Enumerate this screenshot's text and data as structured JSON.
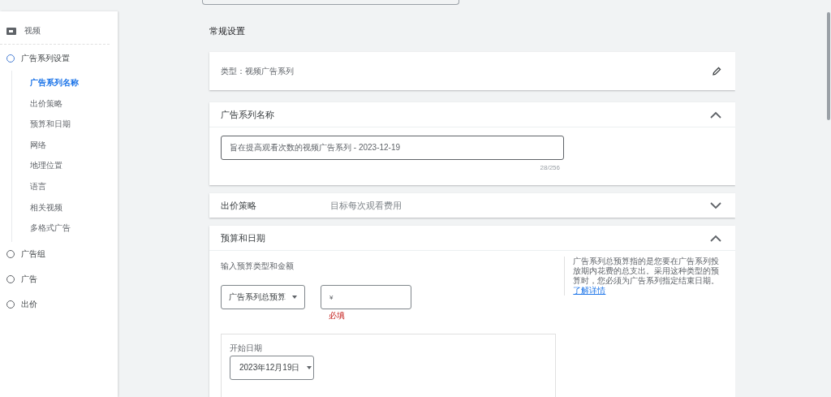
{
  "sidebar": {
    "header": {
      "label": "视频"
    },
    "steps": [
      {
        "label": "广告系列设置",
        "selected": true,
        "children": [
          {
            "label": "广告系列名称",
            "selected": true
          },
          {
            "label": "出价策略",
            "selected": false
          },
          {
            "label": "预算和日期",
            "selected": false
          },
          {
            "label": "网络",
            "selected": false
          },
          {
            "label": "地理位置",
            "selected": false
          },
          {
            "label": "语言",
            "selected": false
          },
          {
            "label": "相关视频",
            "selected": false
          },
          {
            "label": "多格式广告",
            "selected": false
          }
        ]
      },
      {
        "label": "广告组",
        "selected": false
      },
      {
        "label": "广告",
        "selected": false
      },
      {
        "label": "出价",
        "selected": false
      }
    ]
  },
  "main": {
    "section_title": "常规设置",
    "type_card": {
      "text": "类型：视频广告系列"
    },
    "sections": [
      {
        "kind": "name",
        "title": "广告系列名称",
        "expanded": true,
        "value": "旨在提高观看次数的视频广告系列 - 2023-12-19",
        "counter": "28/256"
      },
      {
        "kind": "summary",
        "title": "出价策略",
        "expanded": false,
        "summary": "目标每次观看费用"
      },
      {
        "kind": "budget",
        "title": "预算和日期",
        "expanded": true,
        "prompt": "输入预算类型和金额",
        "budget_type": "广告系列总预算",
        "amount": "¥",
        "error": "必填",
        "start_label": "开始日期",
        "start_date": "2023年12月19日",
        "help": "广告系列总预算指的是您要在广告系列投放期内花费的总支出。采用这种类型的预算时，您必须为广告系列指定结束日期。",
        "link": "了解详情"
      }
    ]
  }
}
